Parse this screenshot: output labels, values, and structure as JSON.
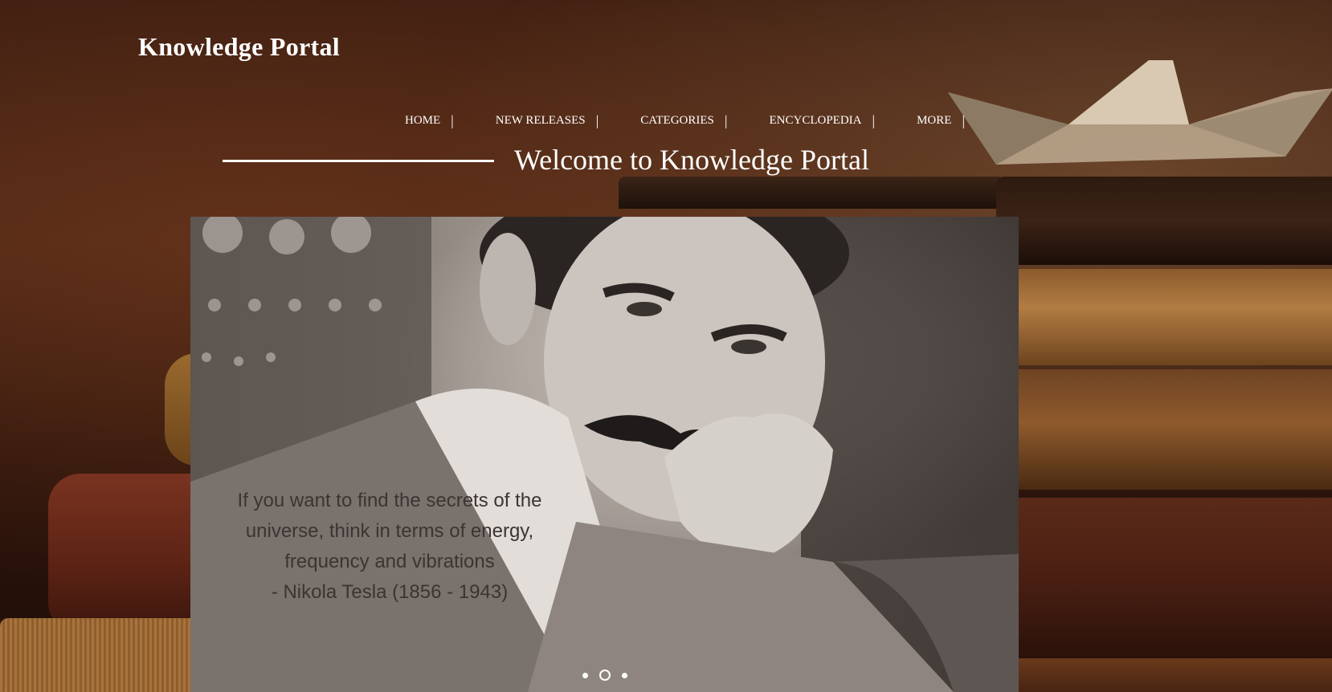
{
  "site": {
    "title": "Knowledge Portal"
  },
  "nav": {
    "items": [
      {
        "label": "HOME",
        "separator": "|"
      },
      {
        "label": "NEW RELEASES",
        "separator": "|"
      },
      {
        "label": "CATEGORIES",
        "separator": "|"
      },
      {
        "label": "ENCYCLOPEDIA",
        "separator": "|"
      },
      {
        "label": "MORE",
        "separator": "|"
      }
    ]
  },
  "welcome": {
    "heading": "Welcome to Knowledge Portal"
  },
  "slider": {
    "quote_lines": [
      "If you want to find the secrets of the",
      "universe, think in terms of energy,",
      "frequency and vibrations",
      "- Nikola Tesla (1856 - 1943)"
    ],
    "dots": 3,
    "active_index": 1
  },
  "colors": {
    "text": "#ffffff",
    "quote_text": "#3a3533",
    "background": "#3a1c10"
  }
}
